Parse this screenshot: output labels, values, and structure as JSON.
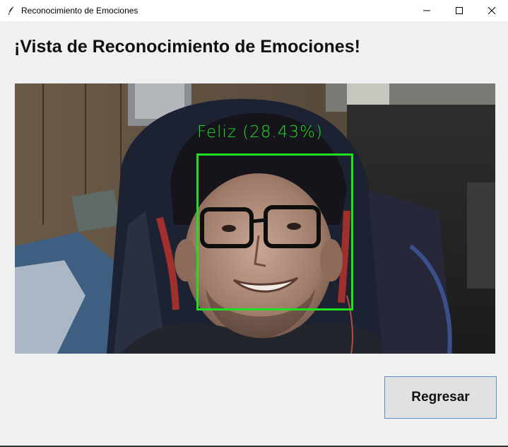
{
  "window": {
    "title": "Reconocimiento de Emociones"
  },
  "main": {
    "heading": "¡Vista de Reconocimiento de Emociones!"
  },
  "camera": {
    "detection_label": "Feliz (28.43%)",
    "detection_color": "#22dd22"
  },
  "actions": {
    "back_label": "Regresar"
  },
  "icons": {
    "app": "feather-icon",
    "minimize": "minimize-icon",
    "maximize": "maximize-icon",
    "close": "close-icon"
  }
}
